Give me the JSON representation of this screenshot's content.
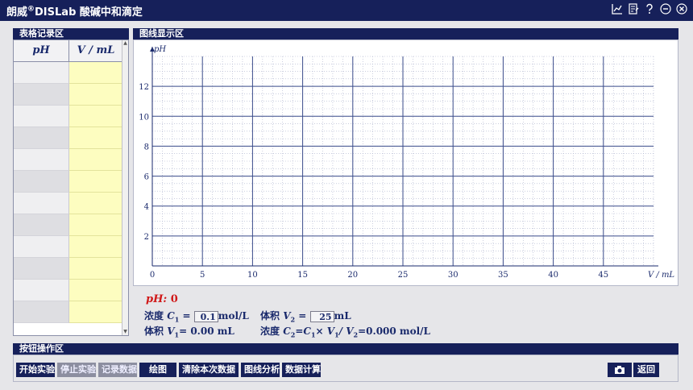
{
  "app": {
    "title_prefix": "朗威",
    "title_reg": "®",
    "title_suffix": "DISLab 酸碱中和滴定"
  },
  "title_icons": [
    "chart-icon",
    "document-icon",
    "help-icon",
    "minimize-icon",
    "close-icon"
  ],
  "table_panel": {
    "title": "表格记录区",
    "headers": [
      "pH",
      "V / mL"
    ],
    "row_count": 12
  },
  "graph_panel": {
    "title": "图线显示区"
  },
  "chart_data": {
    "type": "line",
    "ylabel": "pH",
    "xlabel": "V / mL",
    "xlim": [
      0,
      50
    ],
    "ylim": [
      0,
      14
    ],
    "x_ticks": [
      0,
      5,
      10,
      15,
      20,
      25,
      30,
      35,
      40,
      45
    ],
    "y_ticks": [
      2,
      4,
      6,
      8,
      10,
      12
    ],
    "grid": true,
    "series": []
  },
  "readouts": {
    "ph_label": "pH:",
    "ph_value": "0",
    "c1_label": "浓度",
    "c1_sym": "C",
    "c1_sub": "1",
    "c1_eq": "=",
    "c1_value": "0.1",
    "c1_unit": "mol/L",
    "v2_label": "体积",
    "v2_sym": "V",
    "v2_sub": "2",
    "v2_eq": "=",
    "v2_value": "25",
    "v2_unit": "mL",
    "v1_label": "体积",
    "v1_sym": "V",
    "v1_sub": "1",
    "v1_text": "=  0.00 mL",
    "c2_label": "浓度",
    "c2_text_a": "C",
    "c2_sub_a": "2",
    "c2_text_b": "=C",
    "c2_sub_b": "1",
    "c2_text_c": "× V",
    "c2_sub_c": "1",
    "c2_text_d": "/ V",
    "c2_sub_d": "2",
    "c2_text_e": "=0.000 mol/L"
  },
  "button_panel": {
    "title": "按钮操作区",
    "buttons": {
      "start": "开始实验",
      "stop": "停止实验",
      "record": "记录数据",
      "plot": "绘图",
      "clear": "清除本次数据",
      "analyze": "图线分析",
      "calculate": "数据计算",
      "back": "返回"
    },
    "camera_icon": "camera-icon"
  },
  "colors": {
    "navy": "#16205a",
    "ph_red": "#d01818",
    "input_yellow": "#fdfdc0",
    "grid_major": "#3a4b8a"
  }
}
